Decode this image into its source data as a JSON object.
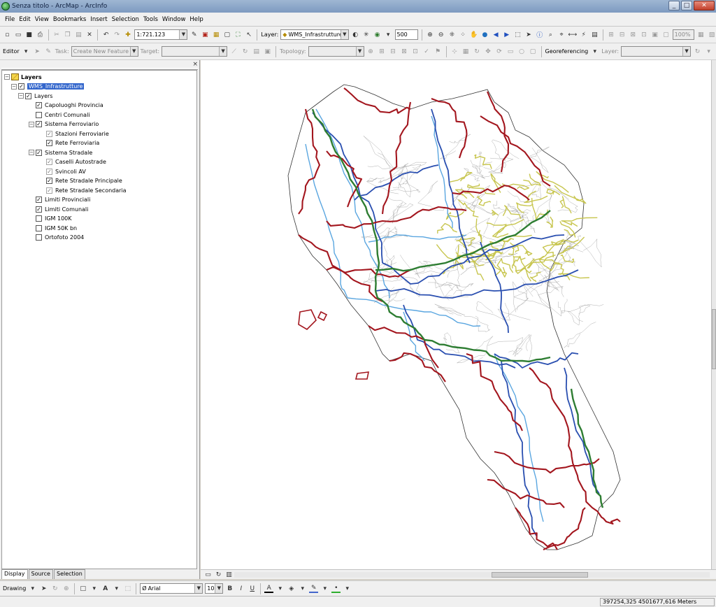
{
  "window": {
    "title": "Senza titolo - ArcMap - ArcInfo",
    "min": "_",
    "max": "□",
    "close": "✕"
  },
  "menu": [
    "File",
    "Edit",
    "View",
    "Bookmarks",
    "Insert",
    "Selection",
    "Tools",
    "Window",
    "Help"
  ],
  "standard_toolbar": {
    "scale": "1:721.123",
    "layer_label": "Layer:",
    "layer_value": "WMS_Infrastrutture",
    "cache_value": "500",
    "zoom_value": "100%"
  },
  "editor_toolbar": {
    "editor_label": "Editor",
    "task_label": "Task:",
    "task_value": "Create New Feature",
    "target_label": "Target:",
    "target_value": "",
    "topology_label": "Topology:",
    "topology_value": "",
    "georef_label": "Georeferencing",
    "georef_layer_label": "Layer:",
    "georef_layer_value": ""
  },
  "toc": {
    "close": "×",
    "tree": [
      {
        "label": "Layers",
        "level": 0,
        "expander": "−",
        "check": "",
        "icon": "layers-icon",
        "bold": true
      },
      {
        "label": "WMS_Infrastrutture",
        "level": 1,
        "expander": "−",
        "check": "✓",
        "selected": true
      },
      {
        "label": "Layers",
        "level": 2,
        "expander": "−",
        "check": "✓"
      },
      {
        "label": "Capoluoghi Provincia",
        "level": 3,
        "expander": "",
        "check": "✓"
      },
      {
        "label": "Centri Comunali",
        "level": 3,
        "expander": "",
        "check": ""
      },
      {
        "label": "Sistema Ferroviario",
        "level": 3,
        "expander": "−",
        "check": "✓"
      },
      {
        "label": "Stazioni Ferroviarie",
        "level": 4,
        "expander": "",
        "check": "✓",
        "grey": true
      },
      {
        "label": "Rete Ferroviaria",
        "level": 4,
        "expander": "",
        "check": "✓"
      },
      {
        "label": "Sistema Stradale",
        "level": 3,
        "expander": "−",
        "check": "✓"
      },
      {
        "label": "Caselli Autostrade",
        "level": 4,
        "expander": "",
        "check": "✓",
        "grey": true
      },
      {
        "label": "Svincoli AV",
        "level": 4,
        "expander": "",
        "check": "✓",
        "grey": true
      },
      {
        "label": "Rete Stradale Principale",
        "level": 4,
        "expander": "",
        "check": "✓"
      },
      {
        "label": "Rete Stradale Secondaria",
        "level": 4,
        "expander": "",
        "check": "✓",
        "grey": true
      },
      {
        "label": "Limiti Provinciali",
        "level": 3,
        "expander": "",
        "check": "✓"
      },
      {
        "label": "Limiti Comunali",
        "level": 3,
        "expander": "",
        "check": "✓"
      },
      {
        "label": "IGM 100K",
        "level": 3,
        "expander": "",
        "check": ""
      },
      {
        "label": "IGM 50K bn",
        "level": 3,
        "expander": "",
        "check": ""
      },
      {
        "label": "Ortofoto 2004",
        "level": 3,
        "expander": "",
        "check": ""
      }
    ],
    "tabs": [
      "Display",
      "Source",
      "Selection"
    ]
  },
  "map": {
    "colors": {
      "primary_roads": "#a3161e",
      "secondary_roads": "#2a4fb0",
      "railways": "#5aa6e0",
      "highways": "#2e7d32",
      "municipal_limits": "#9a9a9a",
      "provincial_limits": "#333333",
      "stations_zone": "#c8c650"
    }
  },
  "drawing_toolbar": {
    "drawing_label": "Drawing",
    "font": "Arial",
    "size": "10",
    "bold": "B",
    "italic": "I",
    "underline": "U",
    "text_a": "A"
  },
  "status": {
    "coordinates": "397254,325  4501677,616 Meters"
  }
}
